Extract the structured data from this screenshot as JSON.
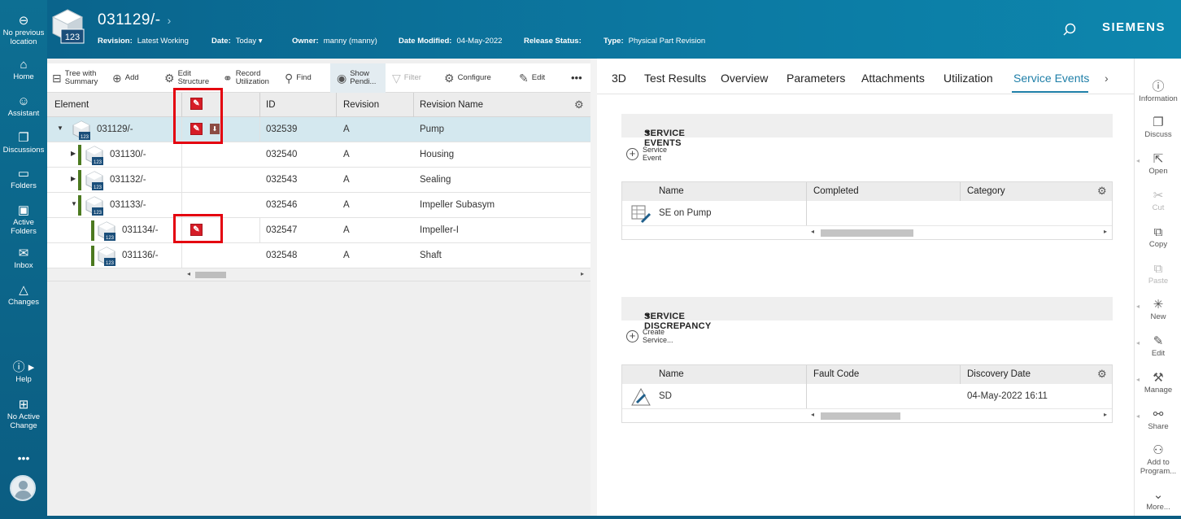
{
  "left_rail": {
    "items": [
      {
        "label_line1": "No previous",
        "label_line2": "location",
        "icon": "back-icon"
      },
      {
        "label_line1": "Home",
        "label_line2": "",
        "icon": "home-icon"
      },
      {
        "label_line1": "Assistant",
        "label_line2": "",
        "icon": "assistant-icon"
      },
      {
        "label_line1": "Discussions",
        "label_line2": "",
        "icon": "discussions-icon"
      },
      {
        "label_line1": "Folders",
        "label_line2": "",
        "icon": "folder-icon"
      },
      {
        "label_line1": "Active",
        "label_line2": "Folders",
        "icon": "active-folders-icon"
      },
      {
        "label_line1": "Inbox",
        "label_line2": "",
        "icon": "inbox-icon"
      },
      {
        "label_line1": "Changes",
        "label_line2": "",
        "icon": "changes-icon"
      },
      {
        "label_line1": "Help",
        "label_line2": "",
        "icon": "help-icon"
      },
      {
        "label_line1": "No Active",
        "label_line2": "Change",
        "icon": "no-active-change-icon"
      }
    ],
    "more": "•••"
  },
  "header": {
    "title": "031129/-",
    "chevron": "›",
    "icon_badge": "123",
    "meta": [
      {
        "label": "Revision:",
        "value": "Latest Working"
      },
      {
        "label": "Date:",
        "value": "Today ▾"
      },
      {
        "label": "Owner:",
        "value": "manny (manny)"
      },
      {
        "label": "Date Modified:",
        "value": "04-May-2022"
      },
      {
        "label": "Release Status:",
        "value": ""
      },
      {
        "label": "Type:",
        "value": "Physical Part Revision"
      }
    ],
    "brand": "SIEMENS"
  },
  "toolbar": {
    "items": [
      {
        "line1": "Tree with",
        "line2": "Summary"
      },
      {
        "line1": "Add",
        "line2": ""
      },
      {
        "line1": "Edit",
        "line2": "Structure"
      },
      {
        "line1": "Record",
        "line2": "Utilization"
      },
      {
        "line1": "Find",
        "line2": ""
      },
      {
        "line1": "Show",
        "line2": "Pendi..."
      },
      {
        "line1": "Filter",
        "line2": ""
      },
      {
        "line1": "Configure",
        "line2": ""
      },
      {
        "line1": "Edit",
        "line2": ""
      }
    ],
    "more": "•••"
  },
  "structure_grid": {
    "columns": {
      "element": "Element",
      "id": "ID",
      "revision": "Revision",
      "revision_name": "Revision Name"
    },
    "badge": "123",
    "rows": [
      {
        "element": "031129/-",
        "id": "032539",
        "revision": "A",
        "revision_name": "Pump"
      },
      {
        "element": "031130/-",
        "id": "032540",
        "revision": "A",
        "revision_name": "Housing"
      },
      {
        "element": "031132/-",
        "id": "032543",
        "revision": "A",
        "revision_name": "Sealing"
      },
      {
        "element": "031133/-",
        "id": "032546",
        "revision": "A",
        "revision_name": "Impeller Subasym"
      },
      {
        "element": "031134/-",
        "id": "032547",
        "revision": "A",
        "revision_name": "Impeller-I"
      },
      {
        "element": "031136/-",
        "id": "032548",
        "revision": "A",
        "revision_name": "Shaft"
      }
    ]
  },
  "tabs": [
    "3D",
    "Test Results",
    "Overview",
    "Parameters",
    "Attachments",
    "Utilization",
    "Service Events"
  ],
  "tab_more": "›",
  "service_events": {
    "title": "SERVICE EVENTS",
    "add_line1": "Service",
    "add_line2": "Event",
    "columns": [
      "Name",
      "Completed",
      "Category"
    ],
    "rows": [
      {
        "name": "SE on Pump",
        "completed": "",
        "category": ""
      }
    ]
  },
  "service_discrepancy": {
    "title": "SERVICE DISCREPANCY",
    "add_line1": "Create",
    "add_line2": "Service...",
    "columns": [
      "Name",
      "Fault Code",
      "Discovery Date"
    ],
    "rows": [
      {
        "name": "SD",
        "fault_code": "",
        "discovery_date": "04-May-2022 16:11"
      }
    ]
  },
  "right_rail": {
    "items": [
      {
        "label_line1": "Information",
        "label_line2": "",
        "icon": "information-icon"
      },
      {
        "label_line1": "Discuss",
        "label_line2": "",
        "icon": "discuss-icon"
      },
      {
        "label_line1": "Open",
        "label_line2": "",
        "icon": "open-icon"
      },
      {
        "label_line1": "Cut",
        "label_line2": "",
        "icon": "cut-icon"
      },
      {
        "label_line1": "Copy",
        "label_line2": "",
        "icon": "copy-icon"
      },
      {
        "label_line1": "Paste",
        "label_line2": "",
        "icon": "paste-icon"
      },
      {
        "label_line1": "New",
        "label_line2": "",
        "icon": "new-icon"
      },
      {
        "label_line1": "Edit",
        "label_line2": "",
        "icon": "edit-icon"
      },
      {
        "label_line1": "Manage",
        "label_line2": "",
        "icon": "manage-icon"
      },
      {
        "label_line1": "Share",
        "label_line2": "",
        "icon": "share-icon"
      },
      {
        "label_line1": "Add to",
        "label_line2": "Program...",
        "icon": "add-to-program-icon"
      },
      {
        "label_line1": "More...",
        "label_line2": "",
        "icon": "more-icon"
      }
    ]
  },
  "colors": {
    "header_bg": "#0a648c",
    "accent": "#1f7fa8",
    "highlight": "#e4000f",
    "service_icon": "#d61d27",
    "tree_bar": "#4c7a20"
  }
}
